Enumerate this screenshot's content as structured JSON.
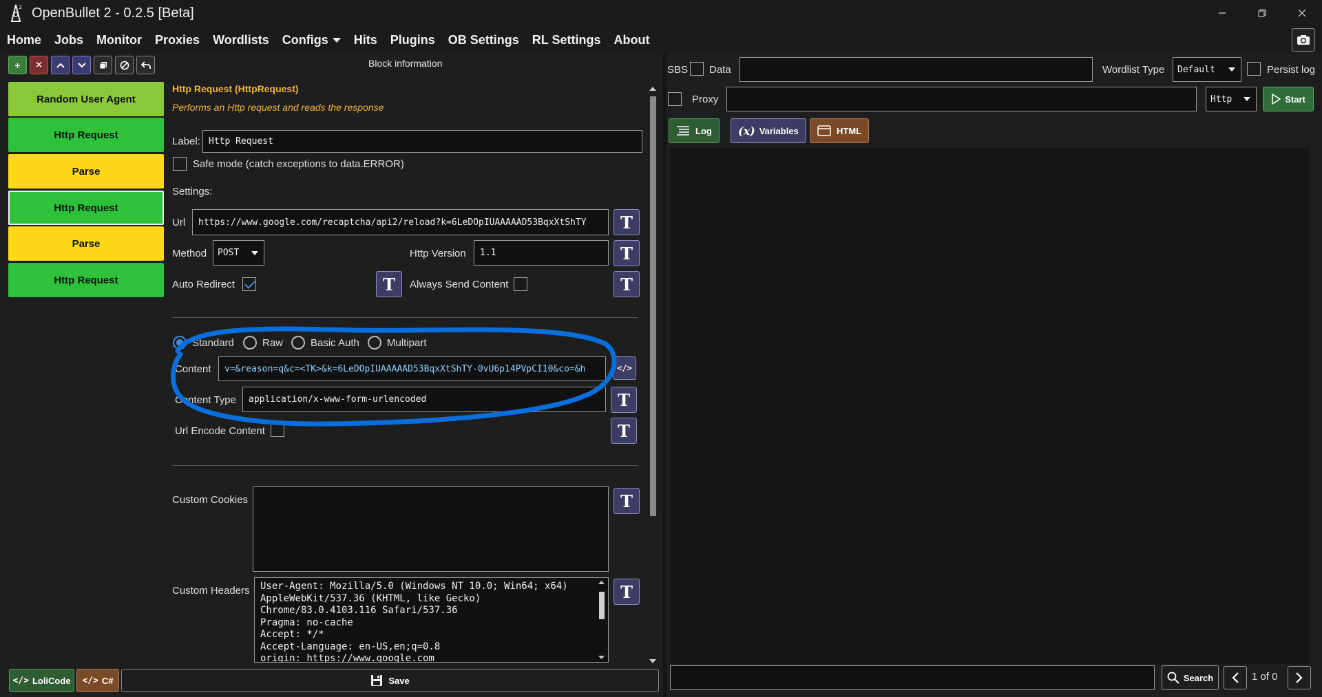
{
  "window": {
    "title": "OpenBullet 2 - 0.2.5 [Beta]",
    "minimize_icon": "minimize-icon",
    "restore_icon": "restore-icon",
    "close_icon": "close-icon"
  },
  "menu": {
    "items": [
      "Home",
      "Jobs",
      "Monitor",
      "Proxies",
      "Wordlists",
      "Configs",
      "Hits",
      "Plugins",
      "OB Settings",
      "RL Settings",
      "About"
    ]
  },
  "blocks": [
    {
      "label": "Random User Agent",
      "color": "#8bc83a"
    },
    {
      "label": "Http Request",
      "color": "#2ec23a"
    },
    {
      "label": "Parse",
      "color": "#fcd817"
    },
    {
      "label": "Http Request",
      "color": "#2ec23a"
    },
    {
      "label": "Parse",
      "color": "#fcd817"
    },
    {
      "label": "Http Request",
      "color": "#2ec23a"
    }
  ],
  "block_info": {
    "header": "Block information",
    "name": "Http Request (HttpRequest)",
    "description": "Performs an Http request and reads the response",
    "label_caption": "Label:",
    "label_value": "Http Request",
    "safe_mode": "Safe mode (catch exceptions to data.ERROR)",
    "settings_caption": "Settings:",
    "url_caption": "Url",
    "url_value": "https://www.google.com/recaptcha/api2/reload?k=6LeDOpIUAAAAAD53BqxXtShTY",
    "method_caption": "Method",
    "method_value": "POST",
    "http_version_caption": "Http Version",
    "http_version_value": "1.1",
    "auto_redirect": "Auto Redirect",
    "always_send_content": "Always Send Content",
    "content_modes": [
      "Standard",
      "Raw",
      "Basic Auth",
      "Multipart"
    ],
    "content_caption": "Content",
    "content_value": "v=&reason=q&c=<TK>&k=6LeDOpIUAAAAAD53BqxXtShTY-0vU6p14PVpCI10&co=&h",
    "content_type_caption": "Content Type",
    "content_type_value": "application/x-www-form-urlencoded",
    "url_encode_content": "Url Encode Content",
    "custom_cookies": "Custom Cookies",
    "custom_headers": "Custom Headers",
    "headers_value": "User-Agent: Mozilla/5.0 (Windows NT 10.0; Win64; x64)\nAppleWebKit/537.36 (KHTML, like Gecko)\nChrome/83.0.4103.116 Safari/537.36\nPragma: no-cache\nAccept: */*\nAccept-Language: en-US,en;q=0.8\norigin: https://www.google.com"
  },
  "bottom_left": {
    "lolicode": "LoliCode",
    "csharp": "C#",
    "save": "Save"
  },
  "debugger": {
    "sbs": "SBS",
    "data": "Data",
    "wordlist_type_caption": "Wordlist Type",
    "wordlist_type_value": "Default",
    "persist_log": "Persist log",
    "proxy": "Proxy",
    "proxy_type": "Http",
    "start": "Start",
    "tabs": [
      "Log",
      "Variables",
      "HTML"
    ],
    "search": "Search",
    "page_counter": "1 of 0"
  }
}
